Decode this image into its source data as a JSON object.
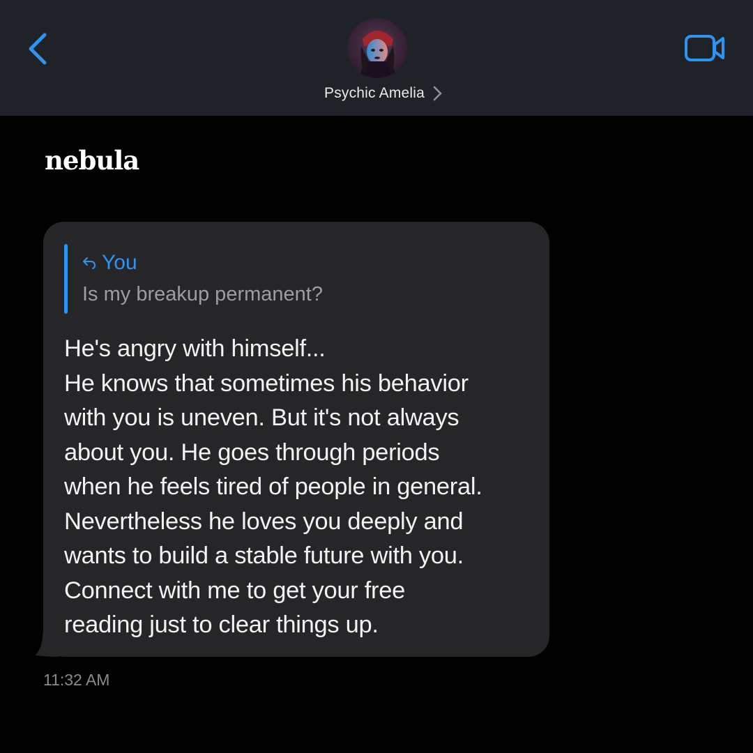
{
  "header": {
    "contact_name": "Psychic Amelia",
    "back_icon": "chevron-left-icon",
    "video_icon": "video-camera-icon",
    "accent_color": "#2f93f2"
  },
  "brand": {
    "name": "nebula"
  },
  "message": {
    "reply": {
      "author": "You",
      "text": "Is my breakup permanent?"
    },
    "lines": [
      "He's angry with himself...",
      "He knows that sometimes his behavior",
      "with you is uneven. But it's not always",
      "about you. He goes through periods",
      "when he feels tired of people in general.",
      "Nevertheless he loves you deeply and",
      "wants to build a stable future with you.",
      "Connect with me to get your free",
      "reading just to clear things up."
    ],
    "timestamp": "11:32 AM"
  }
}
